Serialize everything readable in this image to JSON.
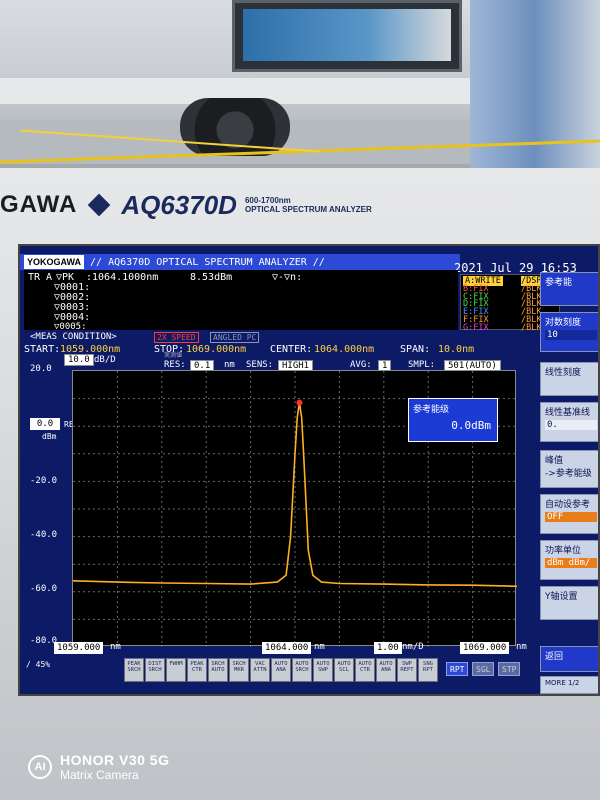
{
  "brand": {
    "maker": "GAWA",
    "model": "AQ6370D",
    "range": "600-1700nm",
    "subtitle": "OPTICAL SPECTRUM ANALYZER"
  },
  "screen": {
    "logo": "YOKOGAWA",
    "title": "// AQ6370D OPTICAL SPECTRUM ANALYZER //",
    "datetime": "2021 Jul 29 16:53",
    "marker": {
      "trace": "TR A",
      "mode": "▽PK",
      "wavelength": ":1064.1000nm",
      "level": "8.53dBm",
      "delta": "▽-▽n:",
      "lines": [
        "▽0001:",
        "▽0002:",
        "▽0003:",
        "▽0004:",
        "▽0005:"
      ]
    },
    "traces": [
      {
        "name": "A:WRITE",
        "state": "/DSP",
        "color": "#ffd23a",
        "bg": "#ffd23a"
      },
      {
        "name": "B:FIX",
        "state": "/BLK",
        "color": "#ff4d4d"
      },
      {
        "name": "C:FIX",
        "state": "/BLK",
        "color": "#4dd94d"
      },
      {
        "name": "D:FIX",
        "state": "/BLK",
        "color": "#4dd94d"
      },
      {
        "name": "E:FIX",
        "state": "/BLK",
        "color": "#4d8cff"
      },
      {
        "name": "F:FIX",
        "state": "/BLK",
        "color": "#ff9a3a"
      },
      {
        "name": "G:FIX",
        "state": "/BLK",
        "color": "#d94dd9"
      }
    ],
    "meas": {
      "label": "<MEAS CONDITION>",
      "speed": "2X SPEED",
      "angled": "ANGLED PC",
      "start_label": "START:",
      "start": "1059.000nm",
      "stop_label": "STOP:",
      "stop": "1069.000nm",
      "center_label": "CENTER:",
      "center": "1064.000nm",
      "span_label": "SPAN:",
      "span": "10.0nm"
    },
    "settings": {
      "scale": "10.0",
      "scale_unit": "dB/D",
      "res_label": "RES:",
      "res_tag": "実測値",
      "res": "0.1",
      "res_unit": "nm",
      "sens_label": "SENS:",
      "sens": "HIGH1",
      "avg_label": "AVG:",
      "avg": "1",
      "smpl_label": "SMPL:",
      "smpl": "501(AUTO)"
    },
    "yaxis": {
      "ticks": [
        "20.0",
        "-20.0",
        "-40.0",
        "-60.0",
        "-80.0"
      ],
      "ref": "0.0",
      "ref_unit": "dBm",
      "ref_label": "REF"
    },
    "popup": {
      "title": "参考能级",
      "value": "0.0dBm"
    },
    "xaxis": {
      "start": "1059.000",
      "center": "1064.000",
      "per_div": "1.00",
      "per_div_unit": "nm/D",
      "stop": "1069.000",
      "unit": "nm"
    },
    "bottom": {
      "zoom": "/ 45%",
      "buttons": [
        "PEAK SRCH",
        "DIST SRCH",
        "FWHM",
        "PEAK CTR",
        "SRCH AUTO",
        "SRCH MKR",
        "VAC ATTN",
        "AUTO ANA",
        "AUTO SRCH",
        "AUTO SWP",
        "AUTO SCL",
        "AUTO CTR",
        "AUTO ANA",
        "SWP REPT",
        "SNG RPT"
      ],
      "rpt": "RPT",
      "sgl": "SGL",
      "stp": "STP"
    },
    "menu": {
      "b1": "参考能",
      "b2_label": "对数刻度",
      "b2_val": "10",
      "b3": "线性刻度",
      "b4_label": "线性基准线",
      "b4_val": "0.",
      "b5_l1": "峰值",
      "b5_l2": "->参考能级",
      "b6_label": "自动设参考",
      "b6_val": "OFF",
      "b7_label": "功率单位",
      "b7_val": "dBm dBm/",
      "b8": "Y轴设置",
      "b9": "返回",
      "more": "MORE 1/2"
    }
  },
  "watermark": {
    "line1": "HONOR V30 5G",
    "line2": "Matrix Camera",
    "icon": "AI"
  },
  "chart_data": {
    "type": "line",
    "x_range": [
      1059.0,
      1069.0
    ],
    "y_range": [
      -80.0,
      20.0
    ],
    "xlabel": "nm",
    "ylabel": "dBm",
    "grid": true,
    "series": [
      {
        "x": [
          1059.0,
          1060.0,
          1061.0,
          1062.0,
          1063.0,
          1063.6,
          1063.8,
          1063.9,
          1064.0,
          1064.05,
          1064.1,
          1064.15,
          1064.2,
          1064.3,
          1064.4,
          1064.6,
          1065.0,
          1066.0,
          1067.0,
          1068.0,
          1069.0
        ],
        "y": [
          -56.0,
          -56.5,
          -56.8,
          -57.0,
          -57.2,
          -56.5,
          -54.0,
          -40.0,
          -10.0,
          3.0,
          8.53,
          3.0,
          -12.0,
          -45.0,
          -54.0,
          -56.5,
          -57.0,
          -57.2,
          -57.5,
          -57.6,
          -58.0
        ],
        "color": "#ffb020"
      }
    ],
    "marker": {
      "x": 1064.1,
      "y": 8.53,
      "color": "#ff3030"
    }
  }
}
